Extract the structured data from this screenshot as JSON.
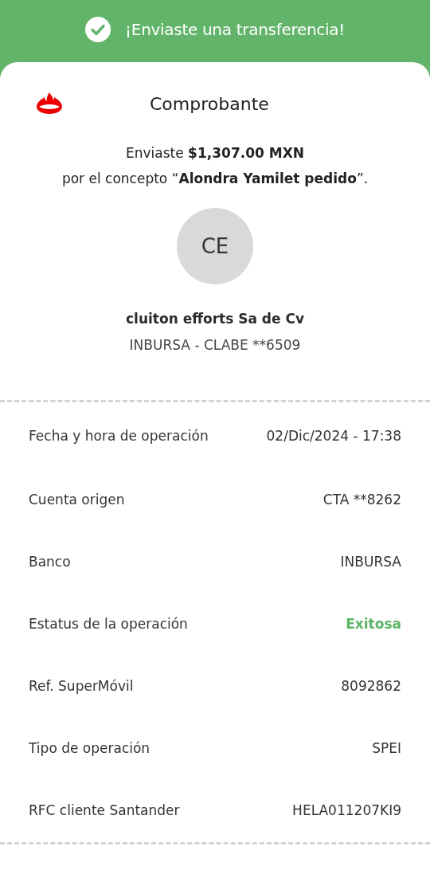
{
  "banner": {
    "title": "¡Enviaste una transferencia!"
  },
  "receipt": {
    "title": "Comprobante",
    "summary": [
      "Enviaste **$1,307.00 MXN**",
      "por el concepto “**Alondra Yamilet pedido**”."
    ],
    "recipient": {
      "initials": "CE",
      "name": "cluiton efforts Sa de Cv",
      "account": "INBURSA - CLABE **6509"
    }
  },
  "details": [
    {
      "kind": "text",
      "label": "Fecha y hora de operación",
      "value": "02/Dic/2024 - 17:38"
    },
    {
      "kind": "text",
      "label": "Cuenta origen",
      "value": "CTA **8262"
    },
    {
      "kind": "text",
      "label": "Banco",
      "value": "INBURSA"
    },
    {
      "kind": "status",
      "label": "Estatus de la operación",
      "value": "Exitosa"
    },
    {
      "kind": "text",
      "label": "Ref. SuperMóvil",
      "value": "8092862"
    },
    {
      "kind": "text",
      "label": "Tipo de operación",
      "value": "SPEI"
    },
    {
      "kind": "text",
      "label": "RFC cliente Santander",
      "value": "HELA011207KI9"
    }
  ]
}
